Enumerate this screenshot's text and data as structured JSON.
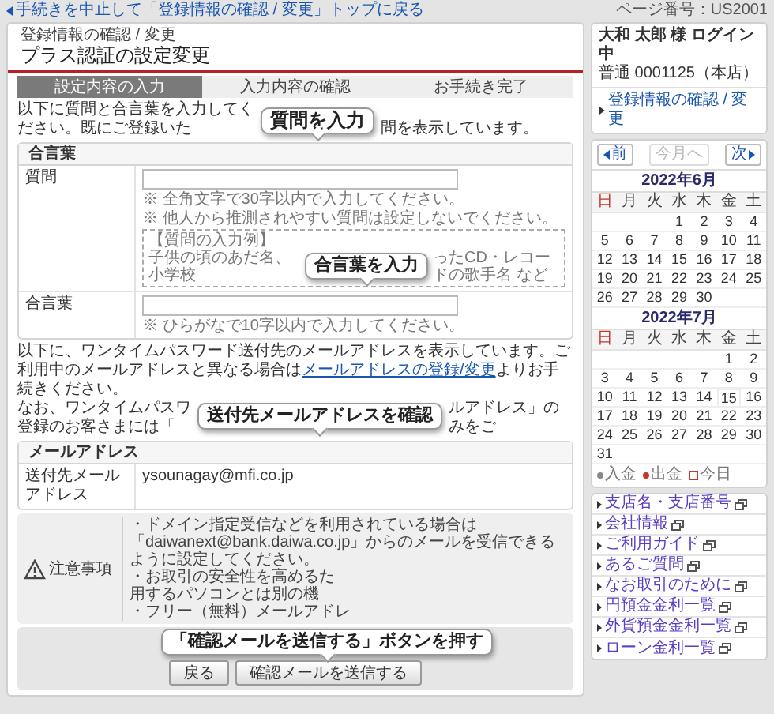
{
  "top_link": "手続きを中止して「登録情報の確認 / 変更」トップに戻る",
  "page_number": "ページ番号：US2001",
  "header": {
    "breadcrumb": "登録情報の確認 / 変更",
    "title": "プラス認証の設定変更"
  },
  "steps": [
    {
      "label": "設定内容の入力",
      "selected": true
    },
    {
      "label": "入力内容の確認",
      "selected": false
    },
    {
      "label": "お手続き完了",
      "selected": false
    }
  ],
  "intro": {
    "before": "以下に質問と合言葉を入力してください。既にご登録いた",
    "callout": "質問を入力",
    "after": "問を表示しています。"
  },
  "passphrase_section": {
    "title": "合言葉",
    "question": {
      "label": "質問",
      "notes": [
        "※ 全角文字で30字以内で入力してください。",
        "※ 他人から推測されやすい質問は設定しないでください。"
      ],
      "example": {
        "title": "【質問の入力例】",
        "before": "子供の頃のあだ名、小学校",
        "callout": "合言葉を入力",
        "after": "ったCD・レコードの歌手名 など"
      }
    },
    "answer": {
      "label": "合言葉",
      "note": "※ ひらがなで10字以内で入力してください。"
    }
  },
  "email_note": {
    "text": "以下に、ワンタイムパスワード送付先のメールアドレスを表示しています。ご利用中のメールアドレスと異なる場合は",
    "link": "メールアドレスの登録/変更",
    "text_after": "よりお手続きください。",
    "fragments_left": [
      "なお、ワンタイムパスワ",
      "登録のお客さまには「"
    ],
    "callout": "送付先メールアドレスを確認",
    "fragment_right": "ルアドレス」のみをご"
  },
  "email_section": {
    "title": "メールアドレス",
    "label": "送付先メールアドレス",
    "value": "ysounagay@mfi.co.jp"
  },
  "notice": {
    "title": "注意事項",
    "first_line": "・ドメイン指定受信などを利用されている場合は「daiwanext@bank.daiwa.co.jp」からのメールを受信できるように設定してください。",
    "fragments": [
      "・お取引の安全性を高めるた",
      "用するパソコンとは別の機",
      "・フリー（無料）メールアドレ"
    ]
  },
  "button_callout": "「確認メールを送信する」ボタンを押す",
  "buttons": [
    "戻る",
    "確認メールを送信する"
  ],
  "user": {
    "name": "大和 太郎 様 ログイン中",
    "account": "普通 0001125（本店）",
    "link": "登録情報の確認 / 変更"
  },
  "calendar": {
    "nav": [
      {
        "label": "前",
        "disabled": false
      },
      {
        "label": "今月へ",
        "disabled": true
      },
      {
        "label": "次",
        "disabled": false
      }
    ],
    "months": [
      {
        "title": "2022年6月",
        "weekdays": [
          {
            "label": "日",
            "holiday": true
          },
          {
            "label": "月",
            "holiday": false
          },
          {
            "label": "火",
            "holiday": false
          },
          {
            "label": "水",
            "holiday": false
          },
          {
            "label": "木",
            "holiday": false
          },
          {
            "label": "金",
            "holiday": false
          },
          {
            "label": "土",
            "holiday": false
          }
        ],
        "weeks": [
          {
            "starts_late": true,
            "days": [
              {
                "day": "1",
                "today": false
              },
              {
                "day": "2",
                "today": false
              },
              {
                "day": "3",
                "today": false
              },
              {
                "day": "4",
                "today": false
              }
            ]
          },
          {
            "days": [
              {
                "day": "5",
                "today": false
              },
              {
                "day": "6",
                "today": false
              },
              {
                "day": "7",
                "today": false
              },
              {
                "day": "8",
                "today": false
              },
              {
                "day": "9",
                "today": false
              },
              {
                "day": "10",
                "today": false
              },
              {
                "day": "11",
                "today": false
              }
            ]
          },
          {
            "days": [
              {
                "day": "12",
                "today": false
              },
              {
                "day": "13",
                "today": false
              },
              {
                "day": "14",
                "today": false
              },
              {
                "day": "15",
                "today": false
              },
              {
                "day": "16",
                "today": false
              },
              {
                "day": "17",
                "today": false
              },
              {
                "day": "18",
                "today": false
              }
            ]
          },
          {
            "days": [
              {
                "day": "19",
                "today": false
              },
              {
                "day": "20",
                "today": false
              },
              {
                "day": "21",
                "today": false
              },
              {
                "day": "22",
                "today": false
              },
              {
                "day": "23",
                "today": false
              },
              {
                "day": "24",
                "today": false
              },
              {
                "day": "25",
                "today": false
              }
            ]
          },
          {
            "starts_late": false,
            "days": [
              {
                "day": "26",
                "today": false
              },
              {
                "day": "27",
                "today": false
              },
              {
                "day": "28",
                "today": false
              },
              {
                "day": "29",
                "today": false
              },
              {
                "day": "30",
                "today": false
              }
            ]
          }
        ]
      },
      {
        "title": "2022年7月",
        "weekdays": [
          {
            "label": "日",
            "holiday": true
          },
          {
            "label": "月",
            "holiday": false
          },
          {
            "label": "火",
            "holiday": false
          },
          {
            "label": "水",
            "holiday": false
          },
          {
            "label": "木",
            "holiday": false
          },
          {
            "label": "金",
            "holiday": false
          },
          {
            "label": "土",
            "holiday": false
          }
        ],
        "weeks": [
          {
            "starts_late": true,
            "days": [
              {
                "day": "1",
                "today": false
              },
              {
                "day": "2",
                "today": false
              }
            ]
          },
          {
            "days": [
              {
                "day": "3",
                "today": false
              },
              {
                "day": "4",
                "today": false
              },
              {
                "day": "5",
                "today": false
              },
              {
                "day": "6",
                "today": false
              },
              {
                "day": "7",
                "today": false
              },
              {
                "day": "8",
                "today": false
              },
              {
                "day": "9",
                "today": false
              }
            ]
          },
          {
            "days": [
              {
                "day": "10",
                "today": false
              },
              {
                "day": "11",
                "today": false
              },
              {
                "day": "12",
                "today": false
              },
              {
                "day": "13",
                "today": false
              },
              {
                "day": "14",
                "today": false
              },
              {
                "day": "15",
                "today": true
              },
              {
                "day": "16",
                "today": false
              }
            ]
          },
          {
            "days": [
              {
                "day": "17",
                "today": false
              },
              {
                "day": "18",
                "today": false
              },
              {
                "day": "19",
                "today": false
              },
              {
                "day": "20",
                "today": false
              },
              {
                "day": "21",
                "today": false
              },
              {
                "day": "22",
                "today": false
              },
              {
                "day": "23",
                "today": false
              }
            ]
          },
          {
            "days": [
              {
                "day": "24",
                "today": false
              },
              {
                "day": "25",
                "today": false
              },
              {
                "day": "26",
                "today": false
              },
              {
                "day": "27",
                "today": false
              },
              {
                "day": "28",
                "today": false
              },
              {
                "day": "29",
                "today": false
              },
              {
                "day": "30",
                "today": false
              }
            ]
          },
          {
            "starts_late": false,
            "days": [
              {
                "day": "31",
                "today": false
              }
            ]
          }
        ]
      }
    ],
    "legend": [
      {
        "label": "入金",
        "kind": "dot",
        "color": "#888888"
      },
      {
        "label": "出金",
        "kind": "dot",
        "color": "#c0392b"
      },
      {
        "label": "今日",
        "kind": "square",
        "color": "#c0392b"
      }
    ]
  },
  "links": [
    "支店名・支店番号",
    "会社情報",
    "ご利用ガイド",
    "あるご質問",
    "なお取引のために",
    "円預金金利一覧",
    "外貨預金金利一覧",
    "ローン金利一覧"
  ]
}
